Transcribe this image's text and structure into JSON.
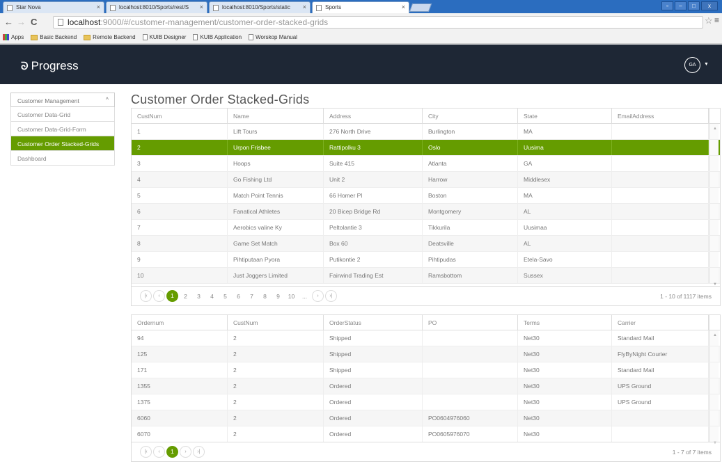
{
  "browser": {
    "tabs": [
      {
        "label": "Star Nova"
      },
      {
        "label": "localhost:8010/Sports/rest/S"
      },
      {
        "label": "localhost:8010/Sports/static"
      },
      {
        "label": "Sports"
      }
    ],
    "url_host": "localhost",
    "url_path": ":9000/#/customer-management/customer-order-stacked-grids",
    "bookmarks": [
      "Apps",
      "Basic Backend",
      "Remote Backend",
      "KUIB Designer",
      "KUIB Application",
      "Worskop Manual"
    ]
  },
  "header": {
    "logo_text": "Progress",
    "avatar_initials": "GA"
  },
  "sidebar": {
    "section_label": "Customer Management",
    "items": [
      {
        "label": "Customer Data-Grid"
      },
      {
        "label": "Customer Data-Grid-Form"
      },
      {
        "label": "Customer Order Stacked-Grids"
      },
      {
        "label": "Dashboard"
      }
    ]
  },
  "main": {
    "title": "Customer Order Stacked-Grids"
  },
  "customer_grid": {
    "columns": [
      "CustNum",
      "Name",
      "Address",
      "City",
      "State",
      "EmailAddress"
    ],
    "rows": [
      [
        "1",
        "Lift Tours",
        "276 North Drive",
        "Burlington",
        "MA",
        ""
      ],
      [
        "2",
        "Urpon Frisbee",
        "Rattipolku 3",
        "Oslo",
        "Uusima",
        ""
      ],
      [
        "3",
        "Hoops",
        "Suite 415",
        "Atlanta",
        "GA",
        ""
      ],
      [
        "4",
        "Go Fishing Ltd",
        "Unit 2",
        "Harrow",
        "Middlesex",
        ""
      ],
      [
        "5",
        "Match Point Tennis",
        "66 Homer Pl",
        "Boston",
        "MA",
        ""
      ],
      [
        "6",
        "Fanatical Athletes",
        "20 Bicep Bridge Rd",
        "Montgomery",
        "AL",
        ""
      ],
      [
        "7",
        "Aerobics valine Ky",
        "Peltolantie 3",
        "Tikkurila",
        "Uusimaa",
        ""
      ],
      [
        "8",
        "Game Set Match",
        "Box 60",
        "Deatsville",
        "AL",
        ""
      ],
      [
        "9",
        "Pihtiputaan Pyora",
        "Putikontie 2",
        "Pihtipudas",
        "Etela-Savo",
        ""
      ],
      [
        "10",
        "Just Joggers Limited",
        "Fairwind Trading Est",
        "Ramsbottom",
        "Sussex",
        ""
      ]
    ],
    "selected_row": 1,
    "pager": {
      "pages": [
        "1",
        "2",
        "3",
        "4",
        "5",
        "6",
        "7",
        "8",
        "9",
        "10",
        "..."
      ],
      "current": "1",
      "info": "1 - 10 of 1117 items"
    }
  },
  "order_grid": {
    "columns": [
      "Ordernum",
      "CustNum",
      "OrderStatus",
      "PO",
      "Terms",
      "Carrier"
    ],
    "rows": [
      [
        "94",
        "2",
        "Shipped",
        "",
        "Net30",
        "Standard Mail"
      ],
      [
        "125",
        "2",
        "Shipped",
        "",
        "Net30",
        "FlyByNight Courier"
      ],
      [
        "171",
        "2",
        "Shipped",
        "",
        "Net30",
        "Standard Mail"
      ],
      [
        "1355",
        "2",
        "Ordered",
        "",
        "Net30",
        "UPS Ground"
      ],
      [
        "1375",
        "2",
        "Ordered",
        "",
        "Net30",
        "UPS Ground"
      ],
      [
        "6060",
        "2",
        "Ordered",
        "PO0604976060",
        "Net30",
        ""
      ],
      [
        "6070",
        "2",
        "Ordered",
        "PO0605976070",
        "Net30",
        ""
      ]
    ],
    "pager": {
      "pages": [
        "1"
      ],
      "current": "1",
      "info": "1 - 7 of 7 items"
    }
  },
  "colors": {
    "accent": "#659c00",
    "header_bg": "#1e2735",
    "tabbar_bg": "#2b6dbf"
  },
  "icons": [
    "page-icon",
    "folder-icon",
    "star-icon",
    "menu-icon",
    "chevron-up-icon",
    "caret-down-icon",
    "first-page-icon",
    "prev-page-icon",
    "next-page-icon",
    "last-page-icon"
  ]
}
